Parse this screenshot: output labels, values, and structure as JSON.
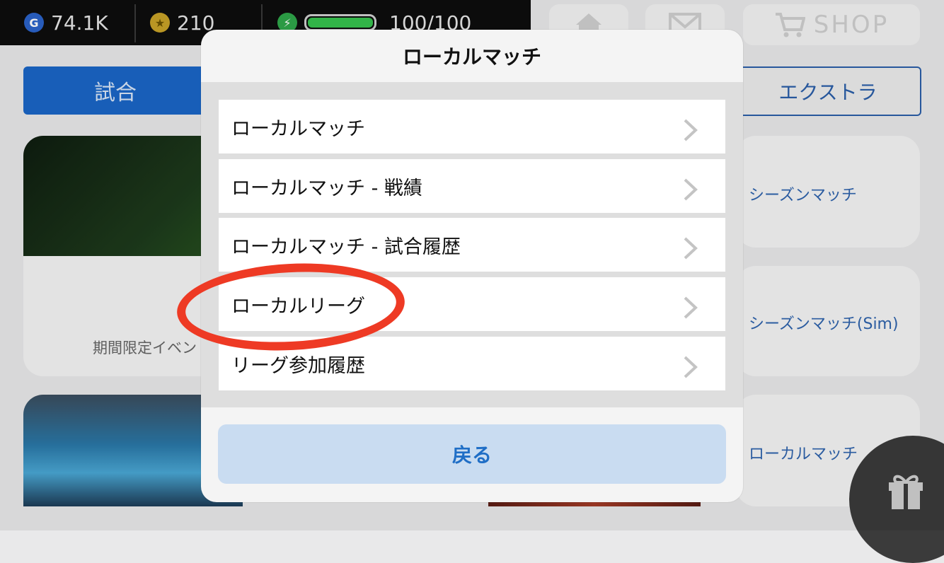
{
  "status": {
    "gp_icon": "G",
    "gp_value": "74.1K",
    "coin_icon": "★",
    "coin_value": "210",
    "stamina_value": "100/100"
  },
  "top_buttons": {
    "home_icon": "home-icon",
    "mail_icon": "mail-icon",
    "shop_label": "SHOP"
  },
  "tabs": {
    "left_label": "試合",
    "right_label": "エクストラ"
  },
  "background_cards": {
    "left_card_text": "期間限定イベン",
    "right_items": [
      "シーズンマッチ",
      "シーズンマッチ(Sim)",
      "ローカルマッチ"
    ]
  },
  "modal": {
    "title": "ローカルマッチ",
    "items": [
      {
        "label": "ローカルマッチ"
      },
      {
        "label": "ローカルマッチ - 戦績"
      },
      {
        "label": "ローカルマッチ - 試合履歴"
      },
      {
        "label": "ローカルリーグ"
      },
      {
        "label": "リーグ参加履歴"
      }
    ],
    "back_label": "戻る"
  },
  "colors": {
    "accent_blue": "#1f6ec6",
    "highlight_red": "#ee3a24",
    "back_button_bg": "#c9dcf1"
  }
}
